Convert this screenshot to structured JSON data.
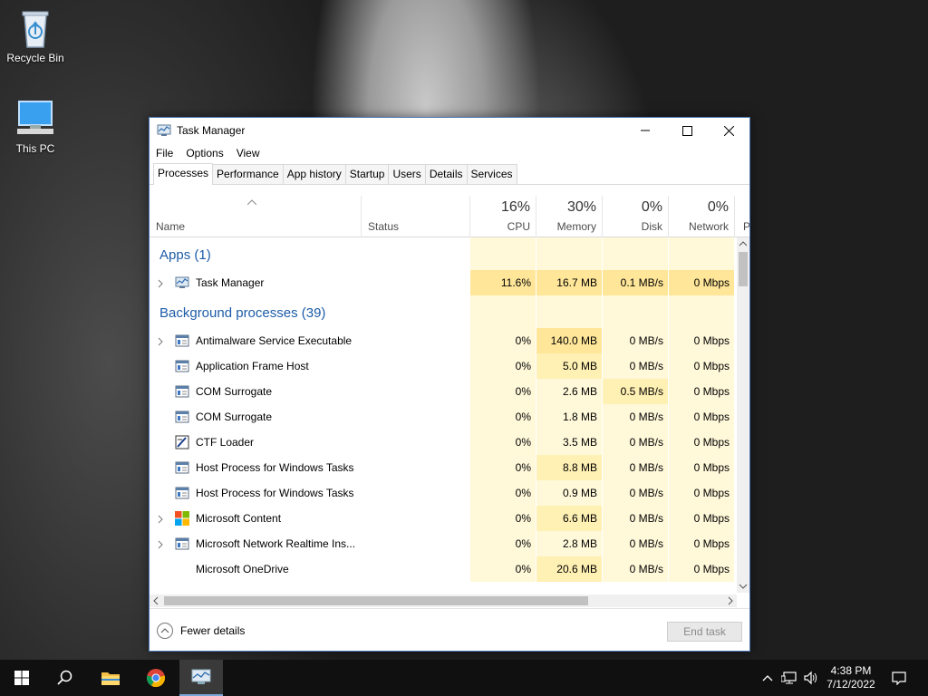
{
  "desktop": {
    "icons": [
      {
        "label": "Recycle Bin",
        "icon": "recycle-bin-icon"
      },
      {
        "label": "This PC",
        "icon": "computer-icon"
      }
    ]
  },
  "window": {
    "title": "Task Manager",
    "menu": [
      "File",
      "Options",
      "View"
    ],
    "tabs": [
      "Processes",
      "Performance",
      "App history",
      "Startup",
      "Users",
      "Details",
      "Services"
    ],
    "active_tab": "Processes"
  },
  "columns": {
    "name": "Name",
    "status": "Status",
    "cpu": {
      "label": "CPU",
      "pct": "16%"
    },
    "memory": {
      "label": "Memory",
      "pct": "30%"
    },
    "disk": {
      "label": "Disk",
      "pct": "0%"
    },
    "network": {
      "label": "Network",
      "pct": "0%"
    },
    "power_partial": "P"
  },
  "groups": {
    "apps": "Apps (1)",
    "background": "Background processes (39)"
  },
  "apps": [
    {
      "name": "Task Manager",
      "expandable": true,
      "icon": "task-manager-icon",
      "cpu": "11.6%",
      "memory": "16.7 MB",
      "disk": "0.1 MB/s",
      "network": "0 Mbps"
    }
  ],
  "background": [
    {
      "name": "Antimalware Service Executable",
      "expandable": true,
      "icon": "service-icon",
      "cpu": "0%",
      "memory": "140.0 MB",
      "disk": "0 MB/s",
      "network": "0 Mbps"
    },
    {
      "name": "Application Frame Host",
      "expandable": false,
      "icon": "service-icon",
      "cpu": "0%",
      "memory": "5.0 MB",
      "disk": "0 MB/s",
      "network": "0 Mbps"
    },
    {
      "name": "COM Surrogate",
      "expandable": false,
      "icon": "service-icon",
      "cpu": "0%",
      "memory": "2.6 MB",
      "disk": "0.5 MB/s",
      "network": "0 Mbps"
    },
    {
      "name": "COM Surrogate",
      "expandable": false,
      "icon": "service-icon",
      "cpu": "0%",
      "memory": "1.8 MB",
      "disk": "0 MB/s",
      "network": "0 Mbps"
    },
    {
      "name": "CTF Loader",
      "expandable": false,
      "icon": "ctf-loader-icon",
      "cpu": "0%",
      "memory": "3.5 MB",
      "disk": "0 MB/s",
      "network": "0 Mbps"
    },
    {
      "name": "Host Process for Windows Tasks",
      "expandable": false,
      "icon": "service-icon",
      "cpu": "0%",
      "memory": "8.8 MB",
      "disk": "0 MB/s",
      "network": "0 Mbps"
    },
    {
      "name": "Host Process for Windows Tasks",
      "expandable": false,
      "icon": "service-icon",
      "cpu": "0%",
      "memory": "0.9 MB",
      "disk": "0 MB/s",
      "network": "0 Mbps"
    },
    {
      "name": "Microsoft Content",
      "expandable": true,
      "icon": "microsoft-logo-icon",
      "cpu": "0%",
      "memory": "6.6 MB",
      "disk": "0 MB/s",
      "network": "0 Mbps"
    },
    {
      "name": "Microsoft Network Realtime Ins...",
      "expandable": true,
      "icon": "service-icon",
      "cpu": "0%",
      "memory": "2.8 MB",
      "disk": "0 MB/s",
      "network": "0 Mbps"
    },
    {
      "name": "Microsoft OneDrive",
      "expandable": false,
      "icon": "none",
      "cpu": "0%",
      "memory": "20.6 MB",
      "disk": "0 MB/s",
      "network": "0 Mbps"
    }
  ],
  "footer": {
    "fewer_details": "Fewer details",
    "end_task": "End task"
  },
  "taskbar": {
    "items": [
      "start-icon",
      "search-icon",
      "file-explorer-icon",
      "chrome-icon",
      "task-manager-icon"
    ],
    "time": "4:38 PM",
    "date": "7/12/2022"
  },
  "colors": {
    "heat_light": "#fff8d9",
    "heat_mid": "#fff0b3",
    "heat_strong": "#ffe699",
    "group_title": "#1d5ca8",
    "accent": "#7aa7d8"
  }
}
